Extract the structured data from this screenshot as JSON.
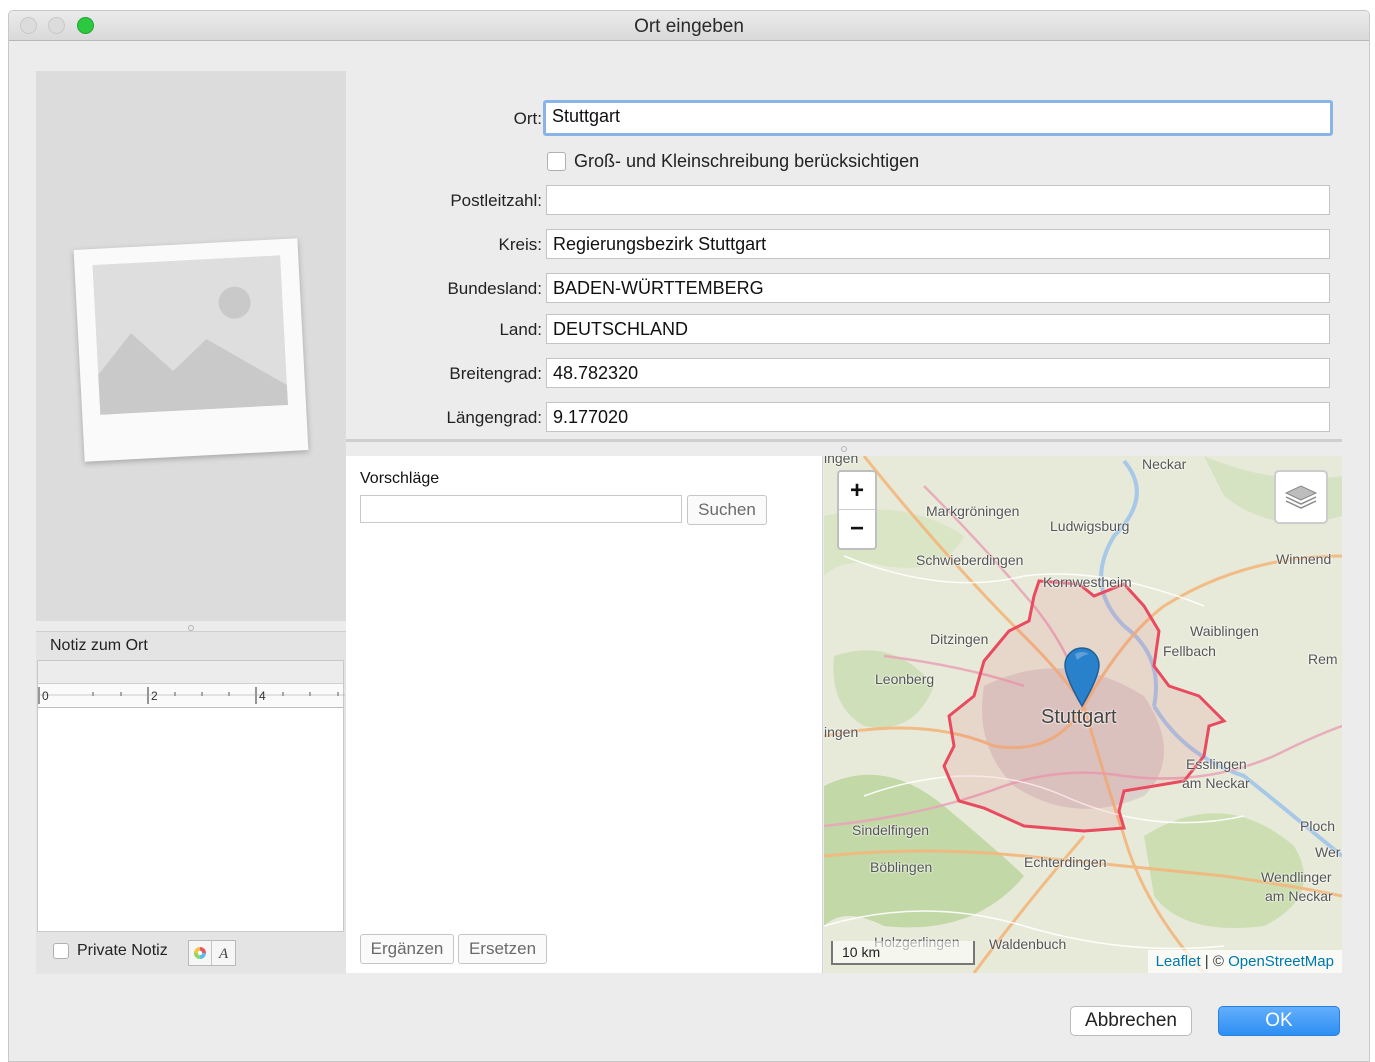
{
  "window": {
    "title": "Ort eingeben"
  },
  "form": {
    "ort": {
      "label": "Ort:",
      "value": "Stuttgart"
    },
    "case_checkbox": {
      "label": "Groß- und Kleinschreibung berücksichtigen",
      "checked": false
    },
    "postleitzahl": {
      "label": "Postleitzahl:",
      "value": ""
    },
    "kreis": {
      "label": "Kreis:",
      "value": "Regierungsbezirk Stuttgart"
    },
    "bundesland": {
      "label": "Bundesland:",
      "value": "BADEN-WÜRTTEMBERG"
    },
    "land": {
      "label": "Land:",
      "value": "DEUTSCHLAND"
    },
    "breitengrad": {
      "label": "Breitengrad:",
      "value": "48.782320"
    },
    "laengengrad": {
      "label": "Längengrad:",
      "value": "9.177020"
    }
  },
  "note": {
    "label": "Notiz zum Ort",
    "ruler_ticks": [
      "0",
      "2",
      "4"
    ],
    "private_label": "Private Notiz",
    "private_checked": false
  },
  "suggestions": {
    "label": "Vorschläge",
    "search_placeholder": "",
    "search_button": "Suchen",
    "add_button": "Ergänzen",
    "replace_button": "Ersetzen"
  },
  "map": {
    "zoom_in": "+",
    "zoom_out": "−",
    "scale": "10 km",
    "attribution_leaflet": "Leaflet",
    "attribution_sep": " | © ",
    "attribution_osm": "OpenStreetMap",
    "places": {
      "top_partial": "ingen",
      "neckar": "Neckar",
      "markgroeningen": "Markgröningen",
      "ludwigsburg": "Ludwigsburg",
      "schwieberdingen": "Schwieberdingen",
      "winnend": "Winnend",
      "kornwestheim": "Kornwestheim",
      "ditzingen": "Ditzingen",
      "waiblingen": "Waiblingen",
      "fellbach": "Fellbach",
      "rem": "Rem",
      "leonberg": "Leonberg",
      "stuttgart": "Stuttgart",
      "left_partial": "ingen",
      "esslingen": "Esslingen",
      "am_neckar_1": "am Neckar",
      "sindelfingen": "Sindelfingen",
      "ploch": "Ploch",
      "wer": "Wer",
      "echterdingen": "Echterdingen",
      "boeblingen": "Böblingen",
      "wendlingen": "Wendlinger",
      "am_neckar_2": "am Neckar",
      "holzgerlingen": "Holzgerlingen",
      "waldenbuch": "Waldenbuch"
    },
    "marker_color": "#2a81cb",
    "border_color": "#e84a5f"
  },
  "buttons": {
    "cancel": "Abbrechen",
    "ok": "OK"
  },
  "colors": {
    "accent": "#2d8ff3",
    "focus_ring": "#8ab4e8"
  }
}
